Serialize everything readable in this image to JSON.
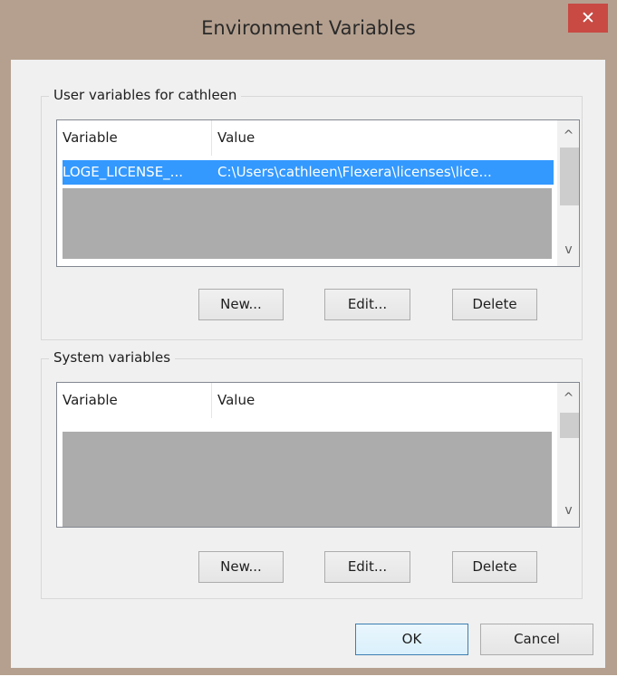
{
  "window": {
    "title": "Environment Variables",
    "close_glyph": "✕"
  },
  "user_vars": {
    "group_label": "User variables for cathleen",
    "columns": [
      "Variable",
      "Value"
    ],
    "selected_row": {
      "variable": "LOGE_LICENSE_...",
      "value": "C:\\Users\\cathleen\\Flexera\\licenses\\lice..."
    },
    "buttons": {
      "new": "New...",
      "edit": "Edit...",
      "delete": "Delete"
    }
  },
  "system_vars": {
    "group_label": "System variables",
    "columns": [
      "Variable",
      "Value"
    ],
    "buttons": {
      "new": "New...",
      "edit": "Edit...",
      "delete": "Delete"
    }
  },
  "footer": {
    "ok": "OK",
    "cancel": "Cancel"
  },
  "icons": {
    "scroll_up": "^",
    "scroll_down": "v"
  },
  "colors": {
    "title_bar": "#b5a08f",
    "close_button": "#c84a43",
    "selection": "#3399ff"
  }
}
